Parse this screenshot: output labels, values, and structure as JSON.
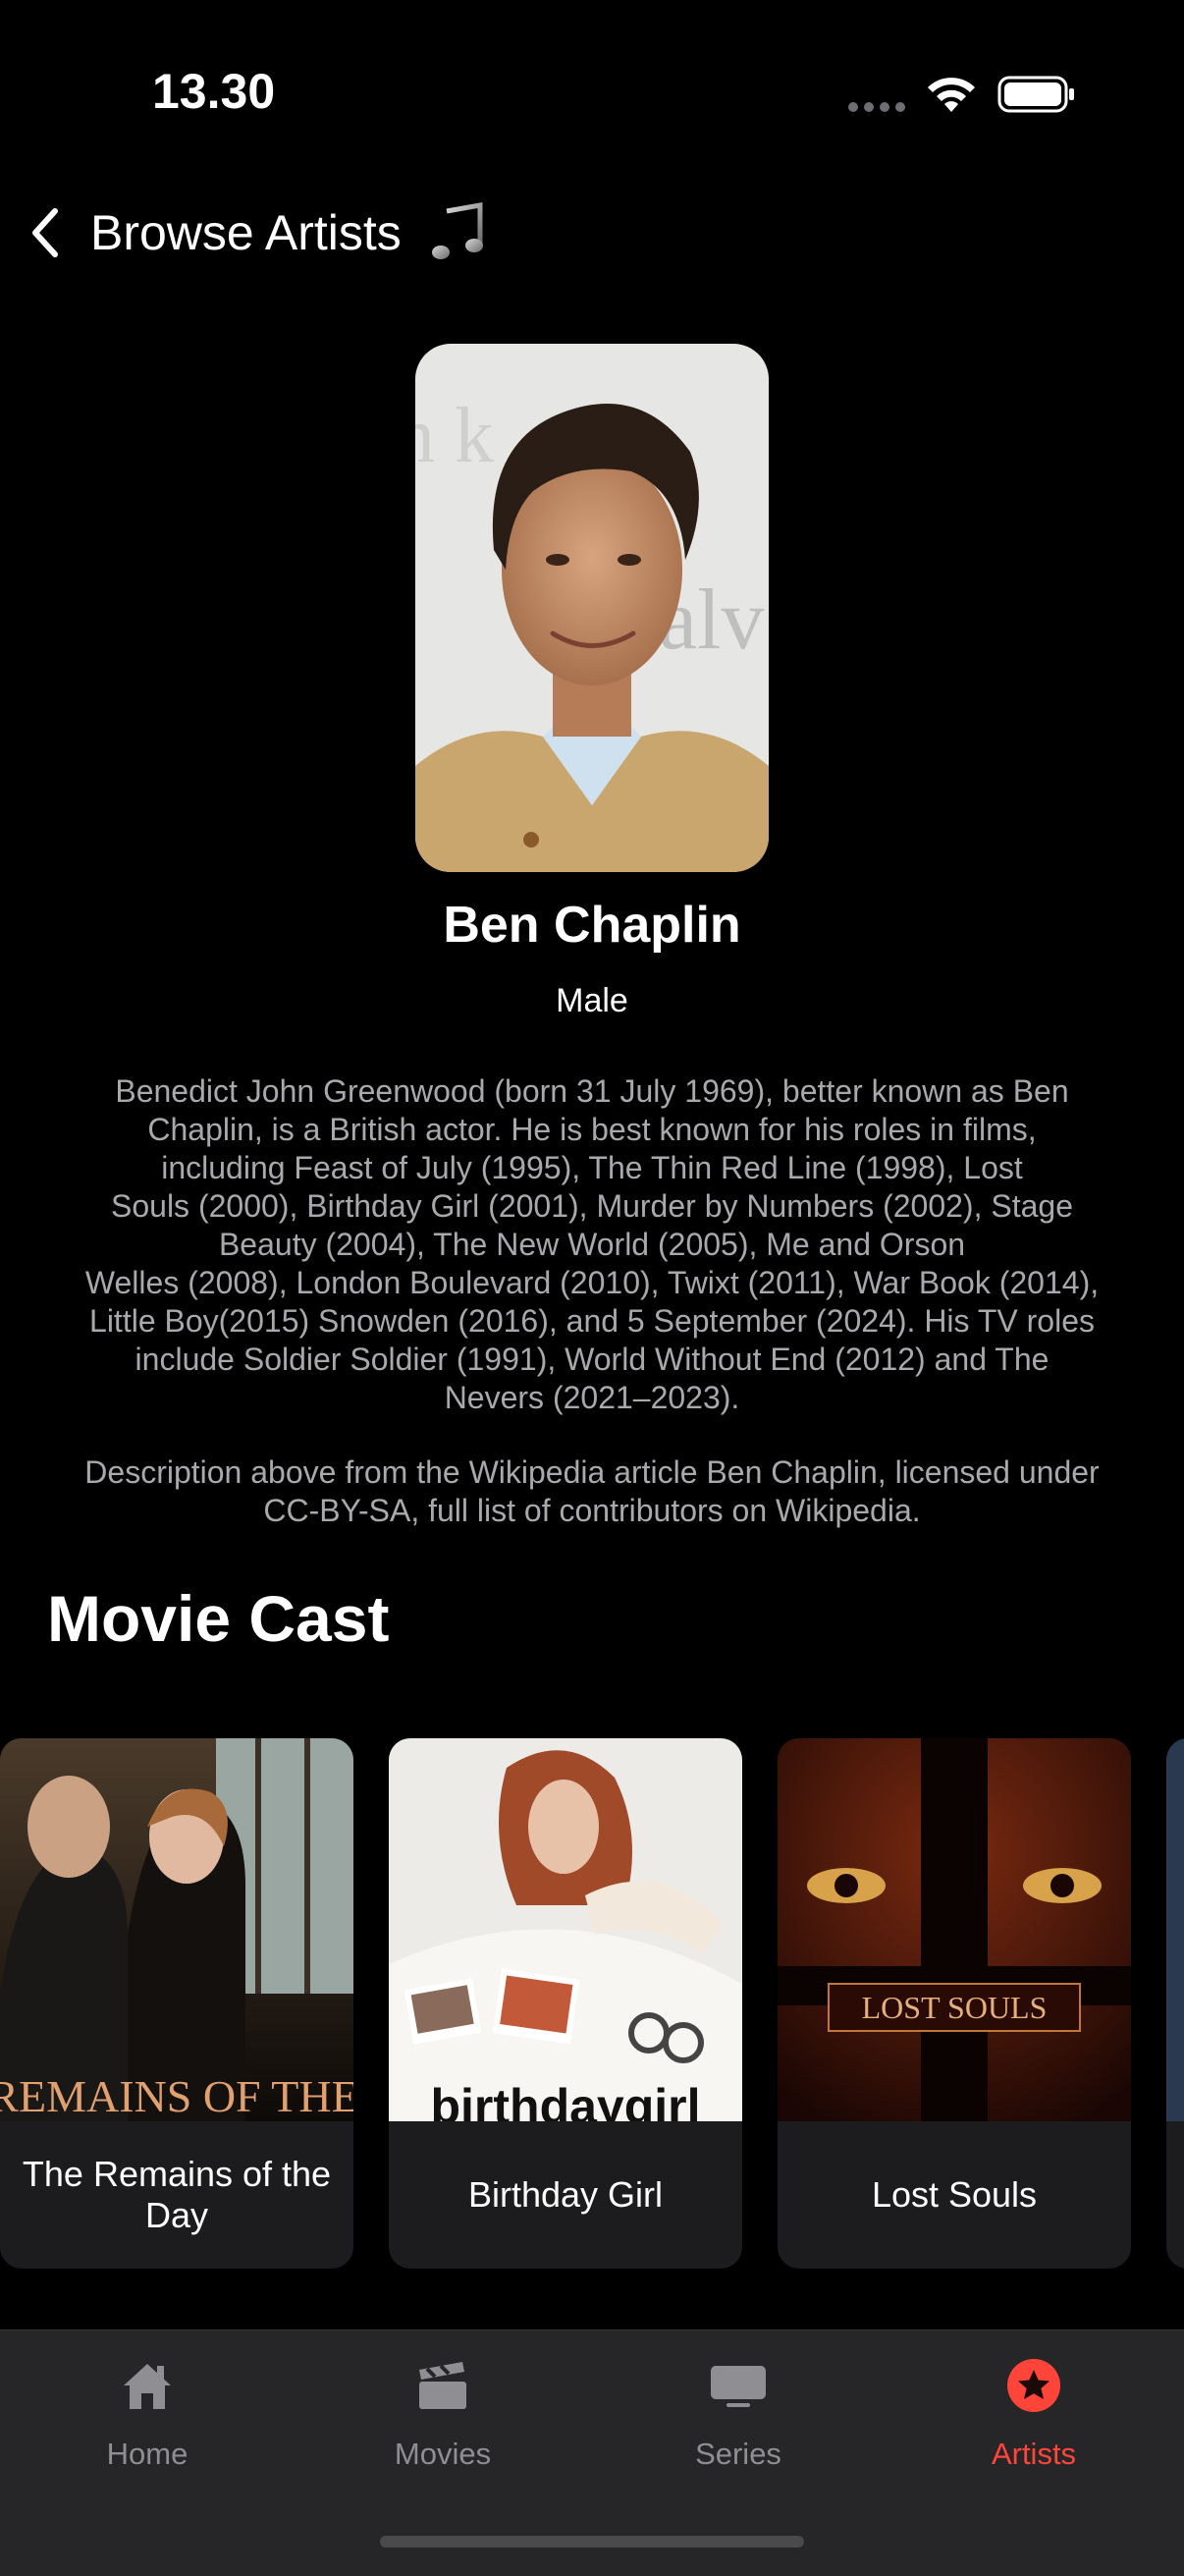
{
  "status_bar": {
    "time": "13.30"
  },
  "nav": {
    "back_title": "Browse Artists"
  },
  "artist": {
    "name": "Ben Chaplin",
    "gender": "Male",
    "biography": "Benedict John Greenwood (born 31 July 1969), better known as Ben\nChaplin, is a British actor. He is best known for his roles in films,\nincluding Feast of July (1995), The Thin Red Line (1998), Lost\nSouls (2000), Birthday Girl (2001), Murder by Numbers (2002), Stage\nBeauty (2004), The New World (2005), Me and Orson\nWelles (2008), London Boulevard (2010), Twixt (2011), War Book (2014),\nLittle Boy(2015) Snowden (2016), and 5 September (2024). His TV roles\ninclude Soldier Soldier (1991), World Without End (2012) and The\nNevers (2021–2023).",
    "credit": "Description above from the Wikipedia article Ben Chaplin, licensed under\nCC-BY-SA, full list of contributors on Wikipedia."
  },
  "movie_cast": {
    "title": "Movie Cast",
    "movies": [
      {
        "title": "The Remains of the Day",
        "poster_text": "THE REMAINS OF THE DAY"
      },
      {
        "title": "Birthday Girl",
        "poster_text": "birthdaygirl"
      },
      {
        "title": "Lost Souls",
        "poster_text": "LOST SOULS"
      }
    ]
  },
  "tabs": [
    {
      "label": "Home",
      "icon": "home-icon",
      "active": false
    },
    {
      "label": "Movies",
      "icon": "clapperboard-icon",
      "active": false
    },
    {
      "label": "Series",
      "icon": "tv-icon",
      "active": false
    },
    {
      "label": "Artists",
      "icon": "star-circle-icon",
      "active": true
    }
  ],
  "colors": {
    "accent": "#ff453a",
    "background": "#000000",
    "card": "#1c1c1e",
    "tabbar": "#262628"
  }
}
